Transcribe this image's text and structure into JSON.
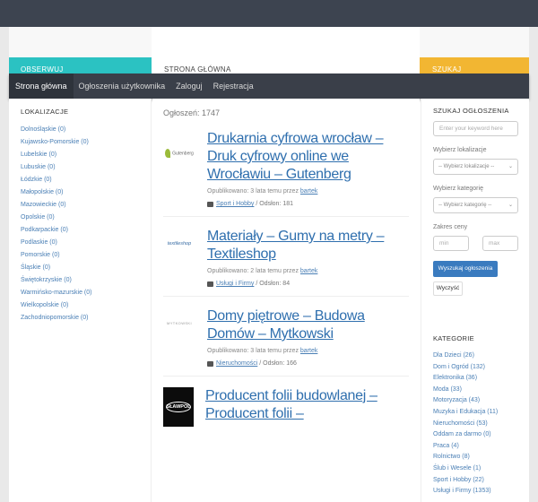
{
  "header": {
    "left_cut": "OBSERWUJ",
    "center_cut": "STRONA GŁÓWNA",
    "right_cut": "SZUKAJ"
  },
  "nav": {
    "items": [
      {
        "label": "Strona główna",
        "active": true
      },
      {
        "label": "Ogłoszenia użytkownika"
      },
      {
        "label": "Zaloguj"
      },
      {
        "label": "Rejestracja"
      }
    ]
  },
  "left_sidebar": {
    "title": "LOKALIZACJE",
    "items": [
      "Dolnośląskie (0)",
      "Kujawsko-Pomorskie (0)",
      "Lubelskie (0)",
      "Lubuskie (0)",
      "Łódzkie (0)",
      "Małopolskie (0)",
      "Mazowieckie (0)",
      "Opolskie (0)",
      "Podkarpackie (0)",
      "Podlaskie (0)",
      "Pomorskie (0)",
      "Śląskie (0)",
      "Świętokrzyskie (0)",
      "Warmińsko-mazurskie (0)",
      "Wielkopolskie (0)",
      "Zachodniopomorskie (0)"
    ]
  },
  "content": {
    "count": "Ogłoszeń: 1747",
    "listings": [
      {
        "title": "Drukarnia cyfrowa wrocław – Druk cyfrowy online we Wrocławiu – Gutenberg",
        "meta": "Opublikowano: 3 lata temu przez",
        "author": "bartek",
        "category": "Sport i Hobby",
        "views": "/ Odsłon: 181",
        "logo_text": "Gutenberg"
      },
      {
        "title": "Materiały – Gumy na metry – Textileshop",
        "meta": "Opublikowano: 2 lata temu przez",
        "author": "bartek",
        "category": "Usługi i Firmy",
        "views": "/ Odsłon: 84",
        "logo_text": "textileshop"
      },
      {
        "title": "Domy piętrowe – Budowa Domów – Mytkowski",
        "meta": "Opublikowano: 3 lata temu przez",
        "author": "bartek",
        "category": "Nieruchomości",
        "views": "/ Odsłon: 166",
        "logo_text": "MYTKOWSKI"
      },
      {
        "title": "Producent folii budowlanej – Producent folii –",
        "logo_text": "SŁAWPOL"
      }
    ]
  },
  "right_sidebar": {
    "title": "SZUKAJ OGŁOSZENIA",
    "keyword_placeholder": "Enter your keyword here",
    "location_label": "Wybierz lokalizacje",
    "location_select": "-- Wybierz lokalizacje --",
    "category_label": "Wybierz kategorię",
    "category_select": "-- Wybierz kategorię --",
    "price_label": "Zakres ceny",
    "min_placeholder": "min",
    "max_placeholder": "max",
    "search_button": "Wyszukaj ogłoszenia",
    "clear_button": "Wyczyść",
    "categories_title": "KATEGORIE",
    "categories": [
      "Dla Dzieci (26)",
      "Dom i Ogród (132)",
      "Elektronika (36)",
      "Moda (33)",
      "Motoryzacja (43)",
      "Muzyka i Edukacja (11)",
      "Nieruchomości (53)",
      "Oddam za darmo (0)",
      "Praca (4)",
      "Rolnictwo (8)",
      "Ślub i Wesele (1)",
      "Sport i Hobby (22)",
      "Usługi i Firmy (1353)"
    ]
  },
  "icons": {
    "category": "folder-icon",
    "chevron": "chevron-down-icon"
  }
}
